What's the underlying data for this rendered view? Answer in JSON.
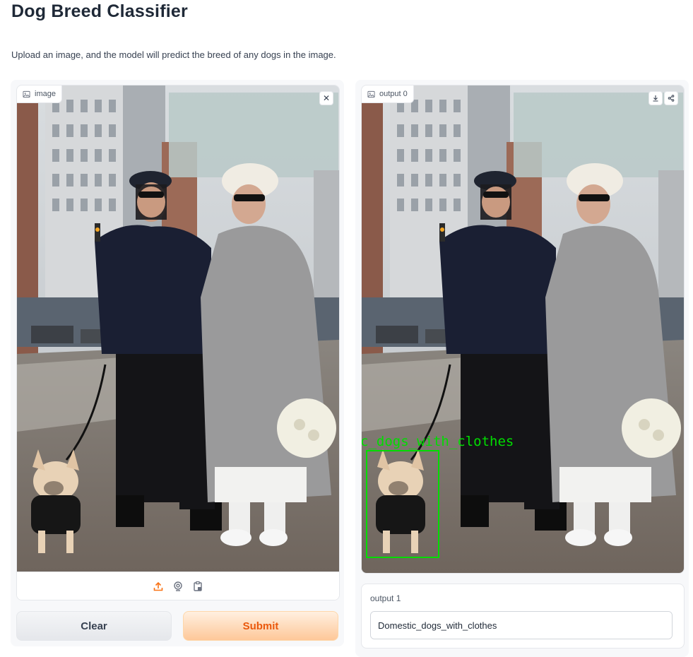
{
  "title": "Dog Breed Classifier",
  "description": "Upload an image, and the model will predict the breed of any dogs in the image.",
  "input": {
    "label": "image",
    "icons": [
      "upload-icon",
      "webcam-icon",
      "clipboard-icon"
    ]
  },
  "output_image": {
    "label": "output 0",
    "detection_label": "c_dogs_with_clothes",
    "box_color": "#00dd00"
  },
  "output_text": {
    "label": "output 1",
    "value": "Domestic_dogs_with_clothes"
  },
  "buttons": {
    "clear": "Clear",
    "submit": "Submit"
  },
  "colors": {
    "accent": "#f97316",
    "submit_text": "#ea580c"
  }
}
